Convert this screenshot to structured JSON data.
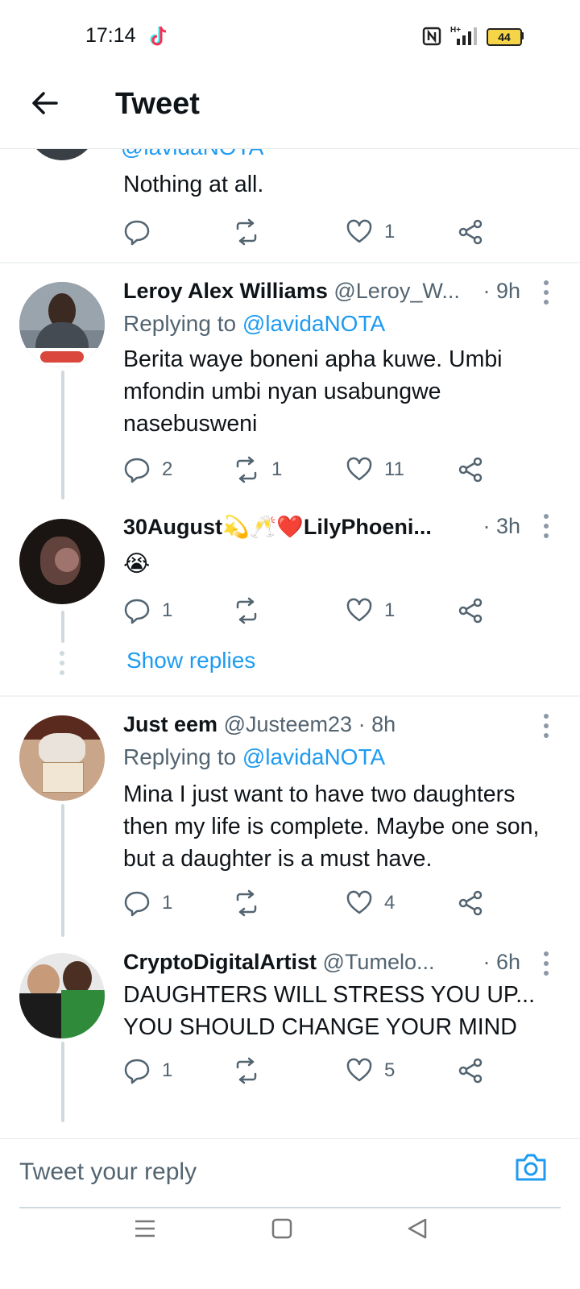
{
  "status_bar": {
    "time": "17:14",
    "battery": "44"
  },
  "header": {
    "title": "Tweet"
  },
  "top_partial": {
    "handle": "@lavidaNOTA",
    "text": "Nothing at all.",
    "likes": "1"
  },
  "tweets": [
    {
      "name": "Leroy Alex Williams",
      "handle": "@Leroy_W...",
      "time": "· 9h",
      "replying_prefix": "Replying to ",
      "replying_to": "@lavidaNOTA",
      "text": "Berita waye boneni apha kuwe. Umbi mfondin umbi nyan usabungwe nasebusweni",
      "replies": "2",
      "retweets": "1",
      "likes": "11"
    },
    {
      "name": "30August",
      "name_emoji": "💫🥂❤️",
      "name_suffix": "LilyPhoeni...",
      "time": "· 3h",
      "text": "😭",
      "replies": "1",
      "retweets": "",
      "likes": "1"
    },
    {
      "name": "Just eem",
      "handle": "@Justeem23",
      "time": "· 8h",
      "replying_prefix": "Replying to ",
      "replying_to": "@lavidaNOTA",
      "text": "Mina I just want to have two daughters then my life is complete. Maybe one son, but a daughter is a must have.",
      "replies": "1",
      "retweets": "",
      "likes": "4"
    },
    {
      "name": "CryptoDigitalArtist",
      "handle": "@Tumelo...",
      "time": "· 6h",
      "text": "DAUGHTERS WILL STRESS YOU UP... YOU SHOULD CHANGE YOUR MIND",
      "replies": "1",
      "retweets": "",
      "likes": "5"
    }
  ],
  "show_replies_label": "Show replies",
  "reply_bar": {
    "placeholder": "Tweet your reply"
  },
  "colors": {
    "accent": "#1d9bf0",
    "text": "#0f1419",
    "secondary": "#536471"
  },
  "icons": [
    "back-arrow-icon",
    "reply-icon",
    "retweet-icon",
    "like-icon",
    "share-icon",
    "more-icon",
    "camera-icon",
    "menu-icon",
    "home-icon",
    "nav-back-icon",
    "tiktok-icon",
    "nfc-icon",
    "signal-icon",
    "battery-icon"
  ]
}
